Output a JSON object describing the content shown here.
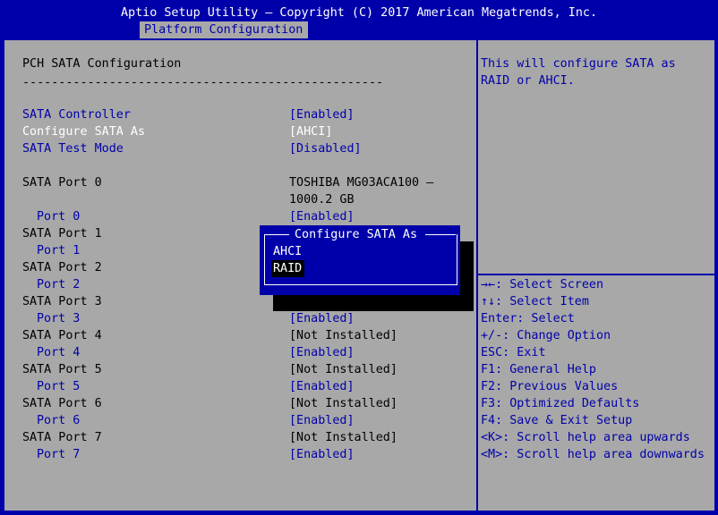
{
  "header": {
    "title": "Aptio Setup Utility – Copyright (C) 2017 American Megatrends, Inc.",
    "active_tab": "Platform Configuration"
  },
  "main": {
    "section_title": "PCH SATA Configuration",
    "divider": "--------------------------------------------------",
    "settings": [
      {
        "label": "SATA Controller",
        "value": "[Enabled]"
      },
      {
        "label": "Configure SATA As",
        "value": "[AHCI]"
      },
      {
        "label": "SATA Test Mode",
        "value": "[Disabled]"
      }
    ],
    "ports": [
      {
        "label": "SATA Port 0",
        "device_line1": "TOSHIBA MG03ACA100 –",
        "device_line2": "1000.2 GB",
        "sub_label": "Port 0",
        "sub_value": "[Enabled]"
      },
      {
        "label": "SATA Port 1",
        "device": "",
        "sub_label": "Port 1",
        "sub_value": ""
      },
      {
        "label": "SATA Port 2",
        "device": "",
        "sub_label": "Port 2",
        "sub_value": ""
      },
      {
        "label": "SATA Port 3",
        "device": "",
        "sub_label": "Port 3",
        "sub_value": "[Enabled]"
      },
      {
        "label": "SATA Port 4",
        "device": "[Not Installed]",
        "sub_label": "Port 4",
        "sub_value": "[Enabled]"
      },
      {
        "label": "SATA Port 5",
        "device": "[Not Installed]",
        "sub_label": "Port 5",
        "sub_value": "[Enabled]"
      },
      {
        "label": "SATA Port 6",
        "device": "[Not Installed]",
        "sub_label": "Port 6",
        "sub_value": "[Enabled]"
      },
      {
        "label": "SATA Port 7",
        "device": "[Not Installed]",
        "sub_label": "Port 7",
        "sub_value": "[Enabled]"
      }
    ]
  },
  "help": {
    "line1": "This will configure SATA as",
    "line2": "RAID or AHCI."
  },
  "keys": [
    "→←: Select Screen",
    "↑↓: Select Item",
    "Enter: Select",
    "+/-: Change Option",
    "ESC: Exit",
    "F1: General Help",
    "F2: Previous Values",
    "F3: Optimized Defaults",
    "F4: Save & Exit Setup",
    "<K>: Scroll help area upwards",
    "<M>: Scroll help area downwards"
  ],
  "popup": {
    "title": "Configure SATA As",
    "options": [
      "AHCI",
      "RAID"
    ],
    "highlighted": "RAID"
  },
  "colors": {
    "background": "#0000aa",
    "panel": "#a8a8a8",
    "text": "#000000",
    "highlight": "#ffffff"
  }
}
